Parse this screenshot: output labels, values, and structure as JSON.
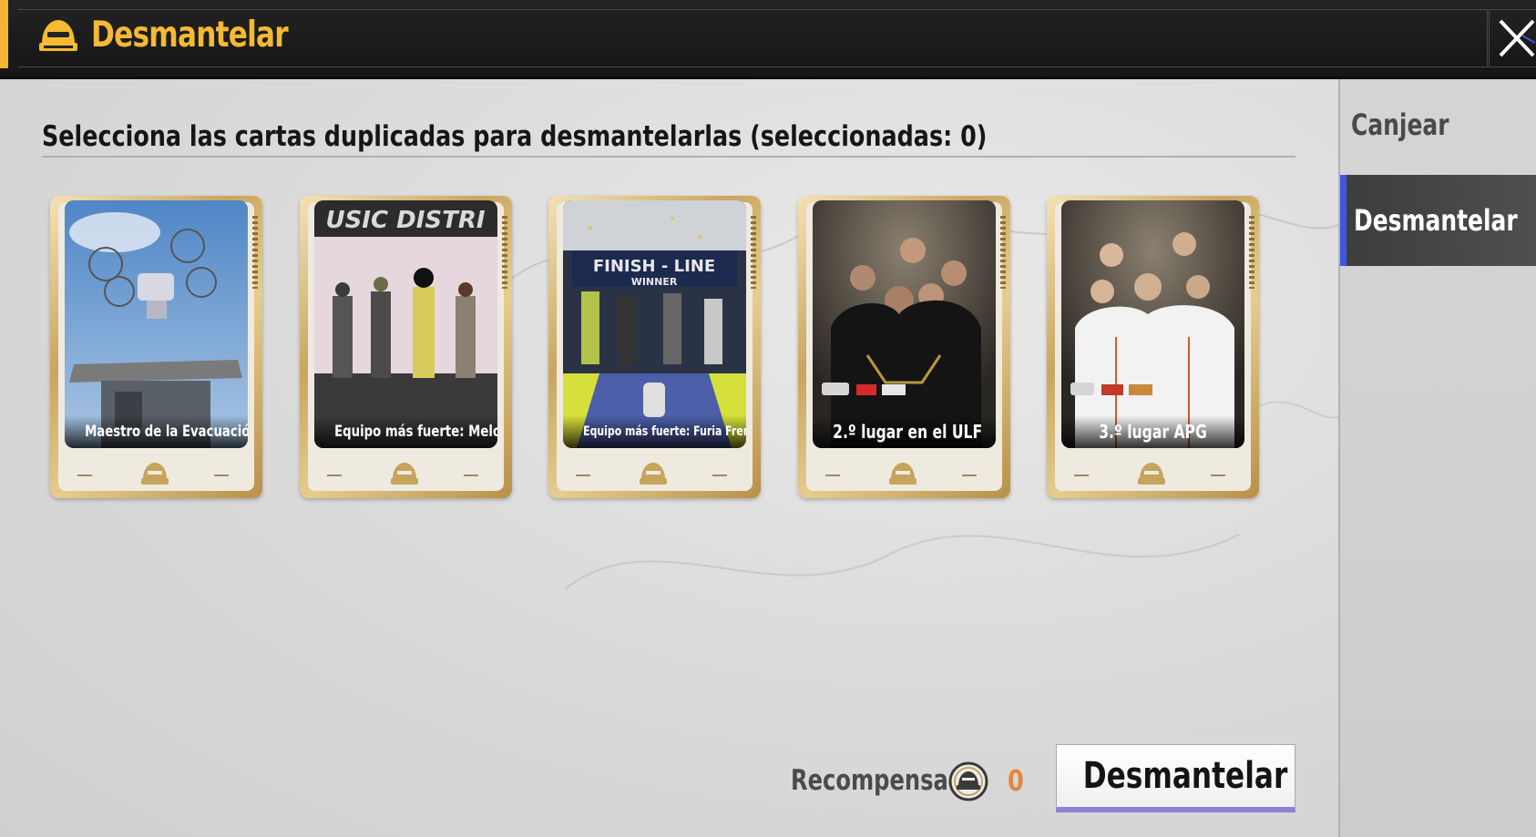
{
  "header": {
    "title": "Desmantelar",
    "icon": "helmet-icon",
    "close_icon": "close-icon"
  },
  "main": {
    "instruction": "Selecciona las cartas duplicadas para desmantelarlas (seleccionadas: 0)",
    "cards": [
      {
        "label": "Maestro de la Evacuación",
        "art": "drone-tower"
      },
      {
        "label": "Equipo más fuerte: Melodía",
        "art": "music-stage",
        "art_text": "USIC DISTRI"
      },
      {
        "label": "Equipo más fuerte: Furia Frenética",
        "art": "finish-line",
        "art_text": "FINISH - LINE",
        "art_subtext": "WINNER"
      },
      {
        "label": "2.º lugar en el ULF",
        "art": "team-photo-dark"
      },
      {
        "label": "3.º lugar APG",
        "art": "team-photo-white"
      }
    ]
  },
  "footer": {
    "reward_label": "Recompensa:",
    "reward_icon": "helmet-coin-icon",
    "reward_value": "0",
    "dismantle_button": "Desmantelar"
  },
  "sidebar": {
    "tabs": [
      {
        "label": "Canjear",
        "active": false
      },
      {
        "label": "Desmantelar",
        "active": true
      }
    ]
  },
  "colors": {
    "title_gold": "#f5b932",
    "accent_orange": "#e5863c",
    "active_tab_bar": "#3f57e0",
    "button_underline": "#8a83d6"
  }
}
